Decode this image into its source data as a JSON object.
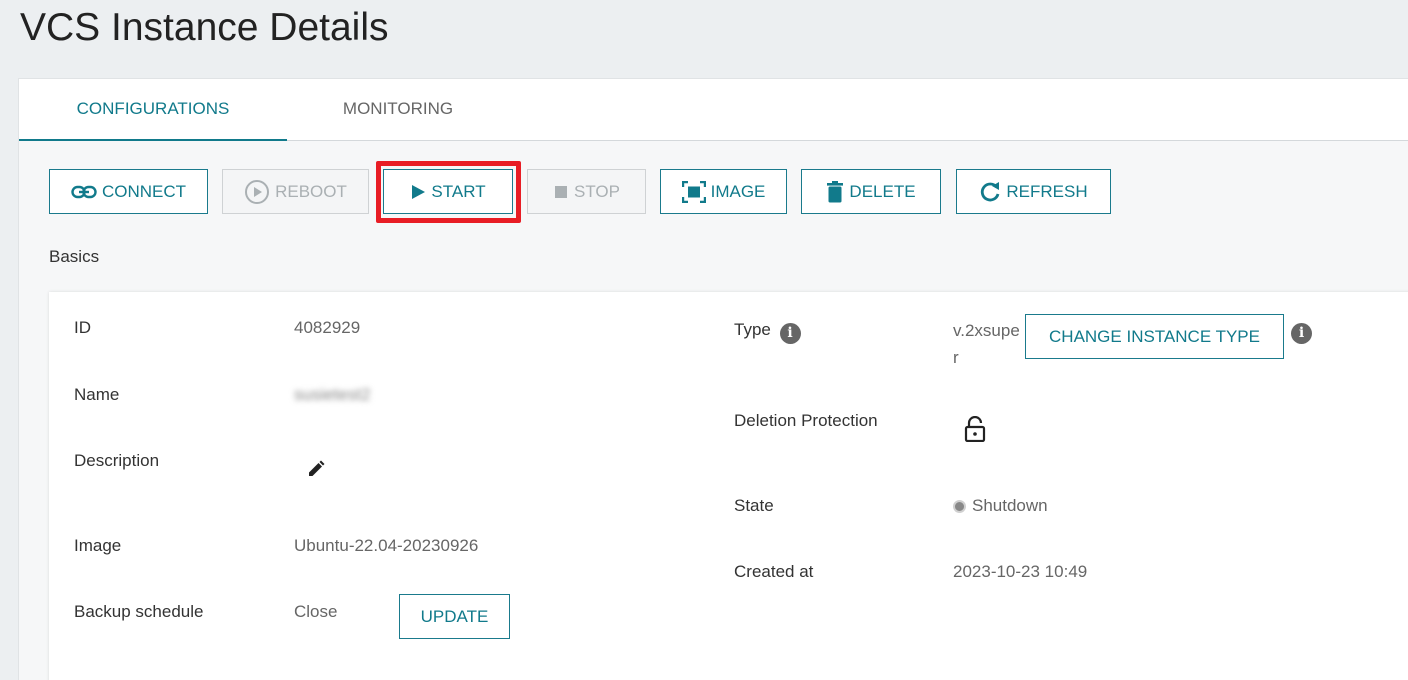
{
  "page": {
    "title": "VCS Instance Details"
  },
  "tabs": [
    {
      "label": "CONFIGURATIONS",
      "active": true
    },
    {
      "label": "MONITORING",
      "active": false
    }
  ],
  "toolbar": {
    "connect_label": "CONNECT",
    "reboot_label": "REBOOT",
    "start_label": "START",
    "stop_label": "STOP",
    "image_label": "IMAGE",
    "delete_label": "DELETE",
    "refresh_label": "REFRESH"
  },
  "basics": {
    "section_label": "Basics",
    "id_label": "ID",
    "id_value": "4082929",
    "name_label": "Name",
    "name_value": "susietest2",
    "description_label": "Description",
    "image_label": "Image",
    "image_value": "Ubuntu-22.04-20230926",
    "backup_label": "Backup schedule",
    "backup_value": "Close",
    "update_label": "UPDATE",
    "type_label": "Type",
    "type_value": "v.2xsuper",
    "change_type_label": "CHANGE INSTANCE TYPE",
    "deletion_protection_label": "Deletion Protection",
    "state_label": "State",
    "state_value": "Shutdown",
    "created_label": "Created at",
    "created_value": "2023-10-23 10:49"
  },
  "icons": {
    "connect": "link-icon",
    "reboot": "play-circle-icon",
    "start": "play-icon",
    "stop": "stop-icon",
    "image": "image-frame-icon",
    "delete": "trash-icon",
    "refresh": "refresh-icon",
    "info": "info-icon",
    "edit": "pencil-icon",
    "lock": "unlock-icon"
  },
  "colors": {
    "accent": "#117a8b",
    "highlight": "#e81d25",
    "disabled": "#aab0b3"
  }
}
